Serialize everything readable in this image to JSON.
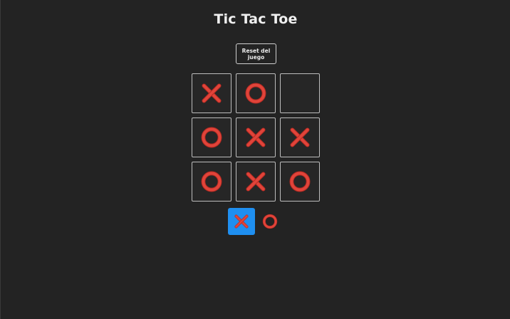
{
  "title": "Tic Tac Toe",
  "reset_label": "Reset del\njuego",
  "board": [
    [
      "X",
      "O",
      ""
    ],
    [
      "O",
      "X",
      "X"
    ],
    [
      "O",
      "X",
      "O"
    ]
  ],
  "player_selector": {
    "options": [
      "X",
      "O"
    ],
    "selected": "X"
  },
  "colors": {
    "background": "#232323",
    "mark": "#e0443a",
    "mark_dark": "#b82a22",
    "selected_bg": "#1f8ff0",
    "cell_border": "#bdbdbd"
  }
}
